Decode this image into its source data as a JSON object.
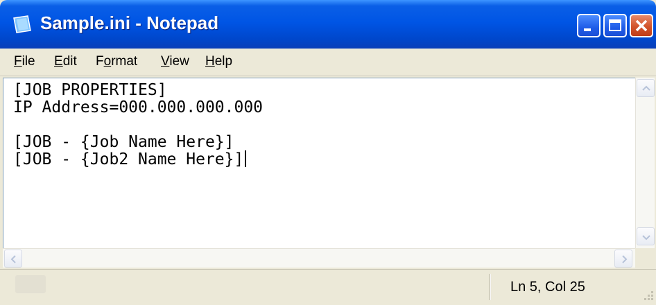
{
  "window": {
    "title": "Sample.ini - Notepad",
    "icon": "notepad-icon"
  },
  "title_buttons": [
    {
      "name": "minimize-button",
      "icon": "minimize-icon"
    },
    {
      "name": "maximize-button",
      "icon": "maximize-icon"
    },
    {
      "name": "close-button",
      "icon": "close-icon"
    }
  ],
  "menu": {
    "file": {
      "mnemonic": "F",
      "rest": "ile"
    },
    "edit": {
      "mnemonic": "E",
      "rest": "dit"
    },
    "format": {
      "pre": "F",
      "mnemonic": "o",
      "rest": "rmat"
    },
    "view": {
      "mnemonic": "V",
      "rest": "iew"
    },
    "help": {
      "mnemonic": "H",
      "rest": "elp"
    }
  },
  "editor": {
    "lines": [
      "[JOB PROPERTIES]",
      "IP Address=000.000.000.000",
      "",
      "[JOB - {Job Name Here}]",
      "[JOB - {Job2 Name Here}]"
    ]
  },
  "status": {
    "position": "Ln 5, Col 25"
  },
  "colors": {
    "titlebar": "#0055e5",
    "close_button": "#d2542b",
    "chrome": "#ece9d8"
  }
}
